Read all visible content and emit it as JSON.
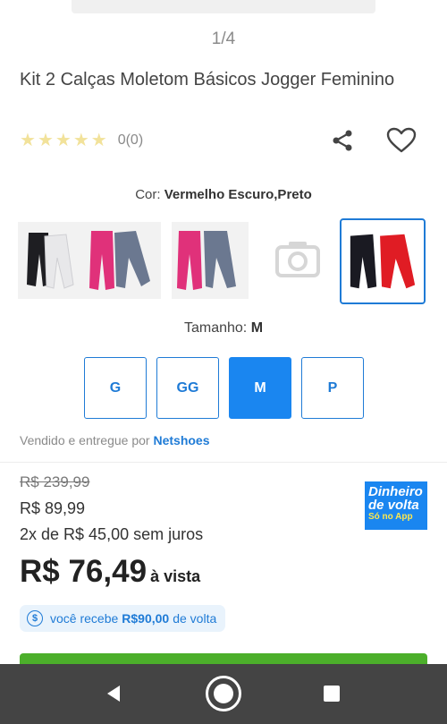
{
  "gallery": {
    "counter": "1/4"
  },
  "product": {
    "title": "Kit 2 Calças Moletom Básicos Jogger Feminino",
    "rating_count": "0(0)",
    "stars": 0
  },
  "color": {
    "label": "Cor:",
    "value": "Vermelho Escuro,Preto",
    "thumbnails": [
      "black-white-pants",
      "pink-grey-pants",
      "pink-grey-pants-2",
      "no-image-placeholder",
      "black-red-pants"
    ],
    "selected_index": 4
  },
  "size": {
    "label": "Tamanho:",
    "value": "M",
    "options": [
      "G",
      "GG",
      "M",
      "P"
    ],
    "selected": "M"
  },
  "seller": {
    "prefix": "Vendido e entregue por",
    "name": "Netshoes"
  },
  "price": {
    "old": "R$ 239,99",
    "current": "R$ 89,99",
    "installment": "2x de R$ 45,00 sem juros",
    "final": "R$ 76,49",
    "final_suffix": "à vista"
  },
  "cashback": {
    "badge_line1": "Dinheiro",
    "badge_line2": "de volta",
    "badge_line3": "Só no App",
    "pill_prefix": "você recebe",
    "pill_amount": "R$90,00",
    "pill_suffix": "de volta"
  },
  "colors": {
    "accent": "#1a86f0",
    "link": "#1f7bd6",
    "buy": "#4caf2b",
    "navbar": "#444444"
  }
}
